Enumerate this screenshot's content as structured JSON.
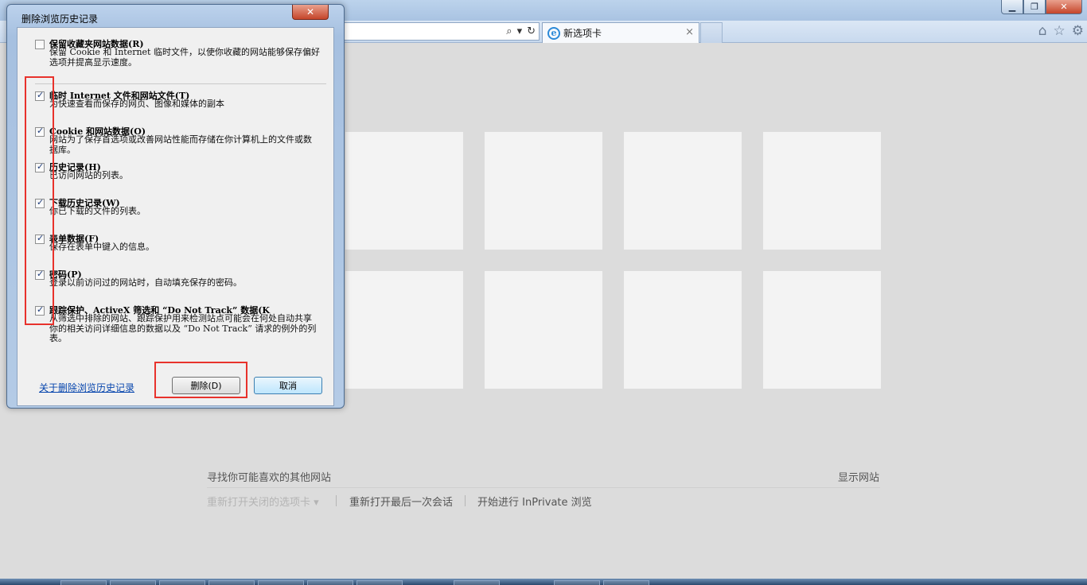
{
  "browser": {
    "tab_title": "新选项卡",
    "tab_close": "×",
    "controls": {
      "min": "▁",
      "max": "❐",
      "close": "✕"
    },
    "address_tools": {
      "search": "⌕",
      "dropdown": "▾",
      "refresh": "↻"
    },
    "nav_icons": {
      "home": "⌂",
      "favorites": "☆",
      "tools": "⚙"
    }
  },
  "content": {
    "find_sites": "寻找你可能喜欢的其他网站",
    "show_sites": "显示网站",
    "reopen_tabs": "重新打开关闭的选项卡 ▾",
    "reopen_session": "重新打开最后一次会话",
    "inprivate": "开始进行 InPrivate 浏览"
  },
  "dialog": {
    "title": "删除浏览历史记录",
    "close": "✕",
    "options": [
      {
        "title": "保留收藏夹网站数据(R)",
        "desc": "保留 Cookie 和 Internet 临时文件，以使你收藏的网站能够保存偏好选项并提高显示速度。",
        "checked": false
      },
      {
        "title": "临时 Internet 文件和网站文件(T)",
        "desc": "为快速查看而保存的网页、图像和媒体的副本",
        "checked": true
      },
      {
        "title": "Cookie 和网站数据(O)",
        "desc": "网站为了保存首选项或改善网站性能而存储在你计算机上的文件或数据库。",
        "checked": true
      },
      {
        "title": "历史记录(H)",
        "desc": "已访问网站的列表。",
        "checked": true
      },
      {
        "title": "下载历史记录(W)",
        "desc": "你已下载的文件的列表。",
        "checked": true
      },
      {
        "title": "表单数据(F)",
        "desc": "保存在表单中键入的信息。",
        "checked": true
      },
      {
        "title": "密码(P)",
        "desc": "登录以前访问过的网站时，自动填充保存的密码。",
        "checked": true
      },
      {
        "title": "跟踪保护、ActiveX 筛选和 “Do Not Track” 数据(K",
        "desc": "从筛选中排除的网站、跟踪保护用来检测站点可能会在何处自动共享你的相关访问详细信息的数据以及 “Do Not Track” 请求的例外的列表。",
        "checked": true
      }
    ],
    "about_link": "关于删除浏览历史记录",
    "delete_button": "删除(D)",
    "cancel_button": "取消"
  },
  "colors": {
    "highlight": "#e8322c",
    "link": "#0645ad"
  }
}
